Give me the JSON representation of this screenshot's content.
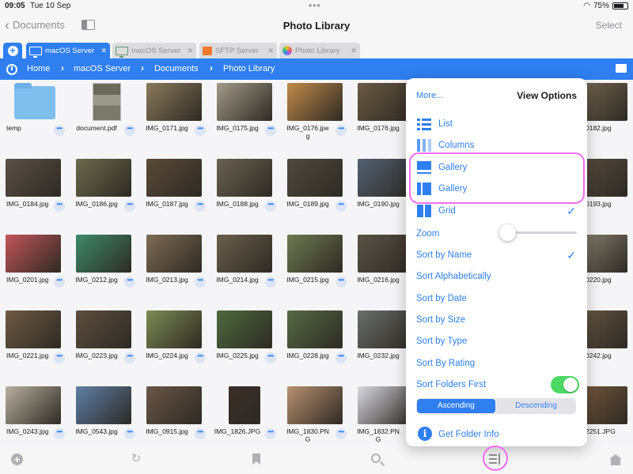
{
  "status": {
    "time": "09:05",
    "date": "Tue 10 Sep",
    "battery": "75%",
    "battery_level": 0.75
  },
  "nav": {
    "back_label": "Documents",
    "title": "Photo Library",
    "select_label": "Select"
  },
  "tabs": [
    {
      "label": "macOS Server",
      "icon": "monitor-icon",
      "close": "✕"
    },
    {
      "label": "macOS Server",
      "icon": "monitor-icon",
      "close": "✕"
    },
    {
      "label": "SFTP Server",
      "icon": "folder-icon",
      "close": "✕"
    },
    {
      "label": "Photo Library",
      "icon": "photos-icon",
      "close": "✕"
    }
  ],
  "breadcrumb": [
    "Home",
    "macOS Server",
    "Documents",
    "Photo Library"
  ],
  "files": [
    {
      "name": "temp",
      "kind": "folder"
    },
    {
      "name": "document.pdf",
      "kind": "doc"
    },
    {
      "name": "IMG_0171.jpg",
      "color": "#8a7a5c"
    },
    {
      "name": "IMG_0175.jpg",
      "color": "#a39a89"
    },
    {
      "name": "IMG_0176.jpe\ng",
      "color": "#c08a4a"
    },
    {
      "name": "IMG_0176.jpg",
      "color": "#6b5a44"
    },
    {
      "name": "IMG_0184.jpg",
      "color": "#5b5048"
    },
    {
      "name": "IMG_0186.jpg",
      "color": "#6c6a4e"
    },
    {
      "name": "IMG_0187.jpg",
      "color": "#5a4a38"
    },
    {
      "name": "IMG_0188.jpg",
      "color": "#6a6252"
    },
    {
      "name": "IMG_0189.jpg",
      "color": "#4e4a3e"
    },
    {
      "name": "IMG_0190.jpg",
      "color": "#536072"
    },
    {
      "name": "IMG_0201.jpg",
      "color": "#c2555a"
    },
    {
      "name": "IMG_0212.jpg",
      "color": "#3e8a6a"
    },
    {
      "name": "IMG_0213.jpg",
      "color": "#7e6b55"
    },
    {
      "name": "IMG_0214.jpg",
      "color": "#6a5f4c"
    },
    {
      "name": "IMG_0215.jpg",
      "color": "#6e7a52"
    },
    {
      "name": "IMG_0216.jpg",
      "color": "#5a5246"
    },
    {
      "name": "IMG_0221.jpg",
      "color": "#6e5a44"
    },
    {
      "name": "IMG_0223.jpg",
      "color": "#5c4e3e"
    },
    {
      "name": "IMG_0224.jpg",
      "color": "#7c8a52"
    },
    {
      "name": "IMG_0225.jpg",
      "color": "#4e6a3e"
    },
    {
      "name": "IMG_0228.jpg",
      "color": "#566a46"
    },
    {
      "name": "IMG_0232.jpg",
      "color": "#6a6e6a"
    },
    {
      "name": "IMG_0243.jpg",
      "color": "#b8b0a0",
      "portrait": false
    },
    {
      "name": "IMG_0543.jpg",
      "color": "#5e7fa6"
    },
    {
      "name": "IMG_0915.jpg",
      "color": "#6a5648"
    },
    {
      "name": "IMG_1826.JPG",
      "color": "#3a2e28",
      "portrait": true
    },
    {
      "name": "IMG_1830.PN\nG",
      "color": "#b89070"
    },
    {
      "name": "IMG_1832.PN\nG",
      "color": "#d8d8e0"
    }
  ],
  "right_files": [
    {
      "name": "0182.jpg",
      "color": "#7a6a54"
    },
    {
      "name": "0193.jpg",
      "color": "#5a4e40"
    },
    {
      "name": "0220.jpg",
      "color": "#8e8676"
    },
    {
      "name": "0242.jpg",
      "color": "#6a5a46"
    },
    {
      "name": "2251.JPG",
      "color": "#7a5a3e"
    }
  ],
  "popover": {
    "more": "More...",
    "title": "View Options",
    "views": [
      {
        "label": "List",
        "icon": "list-icon",
        "checked": false
      },
      {
        "label": "Columns",
        "icon": "columns-icon",
        "checked": false
      },
      {
        "label": "Gallery",
        "icon": "gallery-icon",
        "checked": false
      },
      {
        "label": "Gallery",
        "icon": "gallery-split-icon",
        "checked": false
      },
      {
        "label": "Grid",
        "icon": "grid-icon",
        "checked": true
      }
    ],
    "zoom_label": "Zoom",
    "zoom_level": 0.0,
    "sort_options": [
      {
        "label": "Sort by Name",
        "checked": true
      },
      {
        "label": "Sort Alphabetically",
        "checked": false
      },
      {
        "label": "Sort by Date",
        "checked": false
      },
      {
        "label": "Sort by Size",
        "checked": false
      },
      {
        "label": "Sort by Type",
        "checked": false
      },
      {
        "label": "Sort By Rating",
        "checked": false
      }
    ],
    "folders_first_label": "Sort Folders First",
    "folders_first_on": true,
    "ascending": "Ascending",
    "descending": "Descending",
    "folder_info": "Get Folder Info",
    "checkmark": "✓"
  },
  "colors": {
    "accent": "#2f7ff1",
    "highlight": "#f26df2",
    "toggle_on": "#4cd964"
  },
  "bottom_bar": [
    "add-icon",
    "refresh-icon",
    "bookmark-icon",
    "search-icon",
    "sort-icon",
    "home-icon"
  ]
}
